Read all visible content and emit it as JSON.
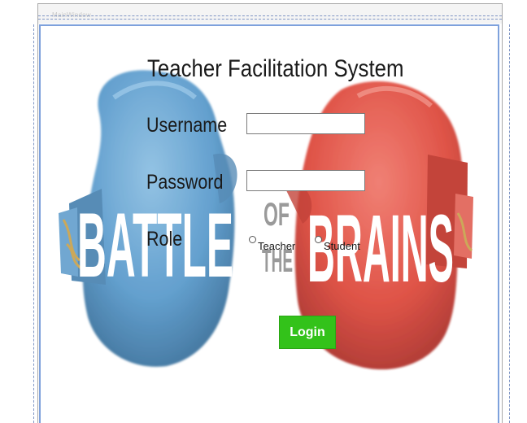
{
  "window": {
    "title": "MainWindow"
  },
  "background_art": {
    "word_left": "BATTLE",
    "word_middle_top": "OF",
    "word_middle_bottom": "THE",
    "word_right": "BRAINS",
    "left_glove_color": "#5b9bcc",
    "right_glove_color": "#de4b3e"
  },
  "form": {
    "title": "Teacher Facilitation System",
    "username_label": "Username",
    "username_value": "",
    "password_label": "Password",
    "password_value": "",
    "role_label": "Role",
    "role_options": [
      {
        "label": "Teacher",
        "selected": false
      },
      {
        "label": "Student",
        "selected": false
      }
    ],
    "login_label": "Login",
    "login_color": "#33c21a"
  }
}
